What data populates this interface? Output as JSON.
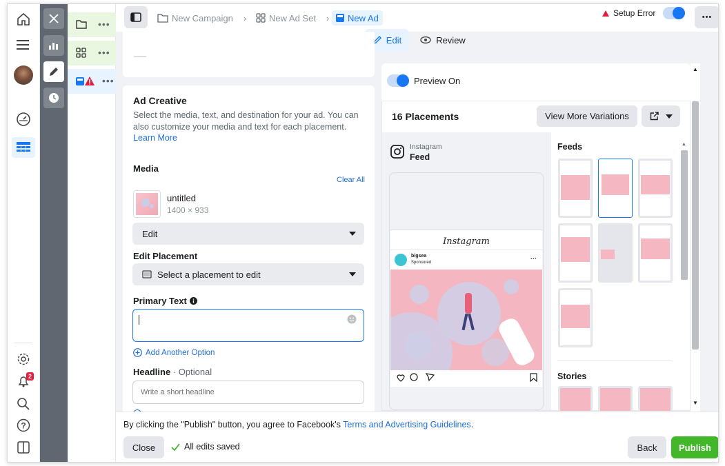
{
  "topbar": {
    "crumbs": [
      "New Campaign",
      "New Ad Set",
      "New Ad"
    ],
    "setup_error": "Setup Error",
    "more": "•••",
    "tabs": [
      "Edit",
      "Review"
    ]
  },
  "tree": {
    "more": "•••"
  },
  "ad_creative": {
    "title": "Ad Creative",
    "description": "Select the media, text, and destination for your ad. You can also customize your media and text for each placement.",
    "learn_more": "Learn More",
    "media_label": "Media",
    "clear_all": "Clear All",
    "media_name": "untitled",
    "media_size": "1400 × 933",
    "edit_select": "Edit",
    "edit_placement_label": "Edit Placement",
    "placement_select": "Select a placement to edit",
    "primary_text_label": "Primary Text",
    "primary_text_value": "",
    "add_option": "Add Another Option",
    "headline_label": "Headline",
    "headline_optional": "· Optional",
    "headline_placeholder": "Write a short headline"
  },
  "preview": {
    "toggle_label": "Preview On",
    "placements_count": "16 Placements",
    "view_more": "View More Variations",
    "platform": "Instagram",
    "position": "Feed",
    "ig_logo_text": "Instagram",
    "account": "bigsea",
    "sponsored": "Sponsored",
    "feeds_label": "Feeds",
    "stories_label": "Stories"
  },
  "footer": {
    "notice_prefix": "By clicking the \"Publish\" button, you agree to Facebook's ",
    "notice_link": "Terms and Advertising Guidelines",
    "notice_suffix": ".",
    "close": "Close",
    "saved": "All edits saved",
    "back": "Back",
    "publish": "Publish"
  },
  "nav": {
    "notifications_badge": "2"
  },
  "colors": {
    "accent": "#1877f2",
    "publish": "#42b72a",
    "error": "#e41e3f",
    "tree_active": "#e7f3ff",
    "tree_hover": "#eaf7e0"
  }
}
